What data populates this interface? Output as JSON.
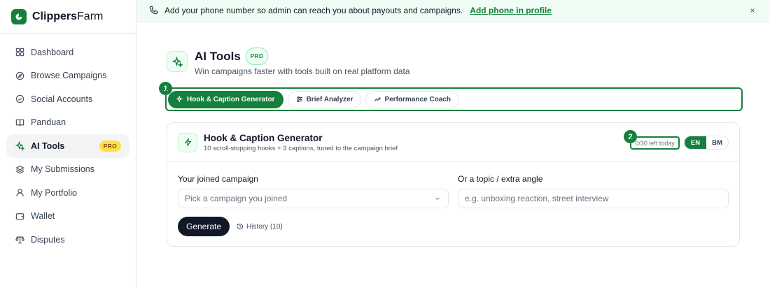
{
  "brand": {
    "name_bold": "Clippers",
    "name_rest": "Farm"
  },
  "sidebar": {
    "items": [
      {
        "label": "Dashboard",
        "icon": "grid-icon"
      },
      {
        "label": "Browse Campaigns",
        "icon": "compass-icon"
      },
      {
        "label": "Social Accounts",
        "icon": "check-circle-icon"
      },
      {
        "label": "Panduan",
        "icon": "book-icon"
      },
      {
        "label": "AI Tools",
        "icon": "sparkles-icon",
        "active": true,
        "badge": "PRO"
      },
      {
        "label": "My Submissions",
        "icon": "layers-icon"
      },
      {
        "label": "My Portfolio",
        "icon": "user-icon"
      },
      {
        "label": "Wallet",
        "icon": "wallet-icon"
      },
      {
        "label": "Disputes",
        "icon": "scale-icon"
      }
    ]
  },
  "banner": {
    "text": "Add your phone number so admin can reach you about payouts and campaigns.",
    "link": "Add phone in profile",
    "close": "×"
  },
  "page": {
    "title": "AI Tools",
    "badge": "PRO",
    "subtitle": "Win campaigns faster with tools built on real platform data"
  },
  "markers": {
    "one": "1",
    "two": "2"
  },
  "tabs": [
    {
      "label": "Hook & Caption Generator",
      "icon": "sparkles-icon",
      "active": true
    },
    {
      "label": "Brief Analyzer",
      "icon": "sliders-icon"
    },
    {
      "label": "Performance Coach",
      "icon": "trend-up-icon"
    }
  ],
  "card": {
    "title": "Hook & Caption Generator",
    "subtitle": "10 scroll-stopping hooks + 3 captions, tuned to the campaign brief",
    "quota": "0/30 left today",
    "languages": [
      "EN",
      "BM"
    ],
    "active_language": "EN",
    "campaign_label": "Your joined campaign",
    "campaign_placeholder": "Pick a campaign you joined",
    "topic_label": "Or a topic / extra angle",
    "topic_placeholder": "e.g. unboxing reaction, street interview",
    "generate_label": "Generate",
    "history_label": "History (10)"
  },
  "colors": {
    "accent": "#15803d",
    "badge_yellow": "#fde047",
    "banner_bg": "#f0fdf4"
  }
}
